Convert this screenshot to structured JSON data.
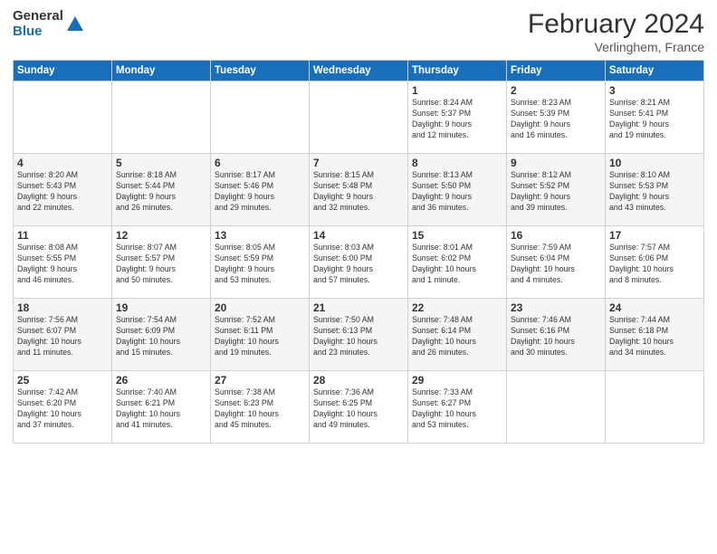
{
  "logo": {
    "general": "General",
    "blue": "Blue"
  },
  "header": {
    "title": "February 2024",
    "subtitle": "Verlinghem, France"
  },
  "weekdays": [
    "Sunday",
    "Monday",
    "Tuesday",
    "Wednesday",
    "Thursday",
    "Friday",
    "Saturday"
  ],
  "weeks": [
    [
      {
        "day": "",
        "info": ""
      },
      {
        "day": "",
        "info": ""
      },
      {
        "day": "",
        "info": ""
      },
      {
        "day": "",
        "info": ""
      },
      {
        "day": "1",
        "info": "Sunrise: 8:24 AM\nSunset: 5:37 PM\nDaylight: 9 hours\nand 12 minutes."
      },
      {
        "day": "2",
        "info": "Sunrise: 8:23 AM\nSunset: 5:39 PM\nDaylight: 9 hours\nand 16 minutes."
      },
      {
        "day": "3",
        "info": "Sunrise: 8:21 AM\nSunset: 5:41 PM\nDaylight: 9 hours\nand 19 minutes."
      }
    ],
    [
      {
        "day": "4",
        "info": "Sunrise: 8:20 AM\nSunset: 5:43 PM\nDaylight: 9 hours\nand 22 minutes."
      },
      {
        "day": "5",
        "info": "Sunrise: 8:18 AM\nSunset: 5:44 PM\nDaylight: 9 hours\nand 26 minutes."
      },
      {
        "day": "6",
        "info": "Sunrise: 8:17 AM\nSunset: 5:46 PM\nDaylight: 9 hours\nand 29 minutes."
      },
      {
        "day": "7",
        "info": "Sunrise: 8:15 AM\nSunset: 5:48 PM\nDaylight: 9 hours\nand 32 minutes."
      },
      {
        "day": "8",
        "info": "Sunrise: 8:13 AM\nSunset: 5:50 PM\nDaylight: 9 hours\nand 36 minutes."
      },
      {
        "day": "9",
        "info": "Sunrise: 8:12 AM\nSunset: 5:52 PM\nDaylight: 9 hours\nand 39 minutes."
      },
      {
        "day": "10",
        "info": "Sunrise: 8:10 AM\nSunset: 5:53 PM\nDaylight: 9 hours\nand 43 minutes."
      }
    ],
    [
      {
        "day": "11",
        "info": "Sunrise: 8:08 AM\nSunset: 5:55 PM\nDaylight: 9 hours\nand 46 minutes."
      },
      {
        "day": "12",
        "info": "Sunrise: 8:07 AM\nSunset: 5:57 PM\nDaylight: 9 hours\nand 50 minutes."
      },
      {
        "day": "13",
        "info": "Sunrise: 8:05 AM\nSunset: 5:59 PM\nDaylight: 9 hours\nand 53 minutes."
      },
      {
        "day": "14",
        "info": "Sunrise: 8:03 AM\nSunset: 6:00 PM\nDaylight: 9 hours\nand 57 minutes."
      },
      {
        "day": "15",
        "info": "Sunrise: 8:01 AM\nSunset: 6:02 PM\nDaylight: 10 hours\nand 1 minute."
      },
      {
        "day": "16",
        "info": "Sunrise: 7:59 AM\nSunset: 6:04 PM\nDaylight: 10 hours\nand 4 minutes."
      },
      {
        "day": "17",
        "info": "Sunrise: 7:57 AM\nSunset: 6:06 PM\nDaylight: 10 hours\nand 8 minutes."
      }
    ],
    [
      {
        "day": "18",
        "info": "Sunrise: 7:56 AM\nSunset: 6:07 PM\nDaylight: 10 hours\nand 11 minutes."
      },
      {
        "day": "19",
        "info": "Sunrise: 7:54 AM\nSunset: 6:09 PM\nDaylight: 10 hours\nand 15 minutes."
      },
      {
        "day": "20",
        "info": "Sunrise: 7:52 AM\nSunset: 6:11 PM\nDaylight: 10 hours\nand 19 minutes."
      },
      {
        "day": "21",
        "info": "Sunrise: 7:50 AM\nSunset: 6:13 PM\nDaylight: 10 hours\nand 23 minutes."
      },
      {
        "day": "22",
        "info": "Sunrise: 7:48 AM\nSunset: 6:14 PM\nDaylight: 10 hours\nand 26 minutes."
      },
      {
        "day": "23",
        "info": "Sunrise: 7:46 AM\nSunset: 6:16 PM\nDaylight: 10 hours\nand 30 minutes."
      },
      {
        "day": "24",
        "info": "Sunrise: 7:44 AM\nSunset: 6:18 PM\nDaylight: 10 hours\nand 34 minutes."
      }
    ],
    [
      {
        "day": "25",
        "info": "Sunrise: 7:42 AM\nSunset: 6:20 PM\nDaylight: 10 hours\nand 37 minutes."
      },
      {
        "day": "26",
        "info": "Sunrise: 7:40 AM\nSunset: 6:21 PM\nDaylight: 10 hours\nand 41 minutes."
      },
      {
        "day": "27",
        "info": "Sunrise: 7:38 AM\nSunset: 6:23 PM\nDaylight: 10 hours\nand 45 minutes."
      },
      {
        "day": "28",
        "info": "Sunrise: 7:36 AM\nSunset: 6:25 PM\nDaylight: 10 hours\nand 49 minutes."
      },
      {
        "day": "29",
        "info": "Sunrise: 7:33 AM\nSunset: 6:27 PM\nDaylight: 10 hours\nand 53 minutes."
      },
      {
        "day": "",
        "info": ""
      },
      {
        "day": "",
        "info": ""
      }
    ]
  ]
}
